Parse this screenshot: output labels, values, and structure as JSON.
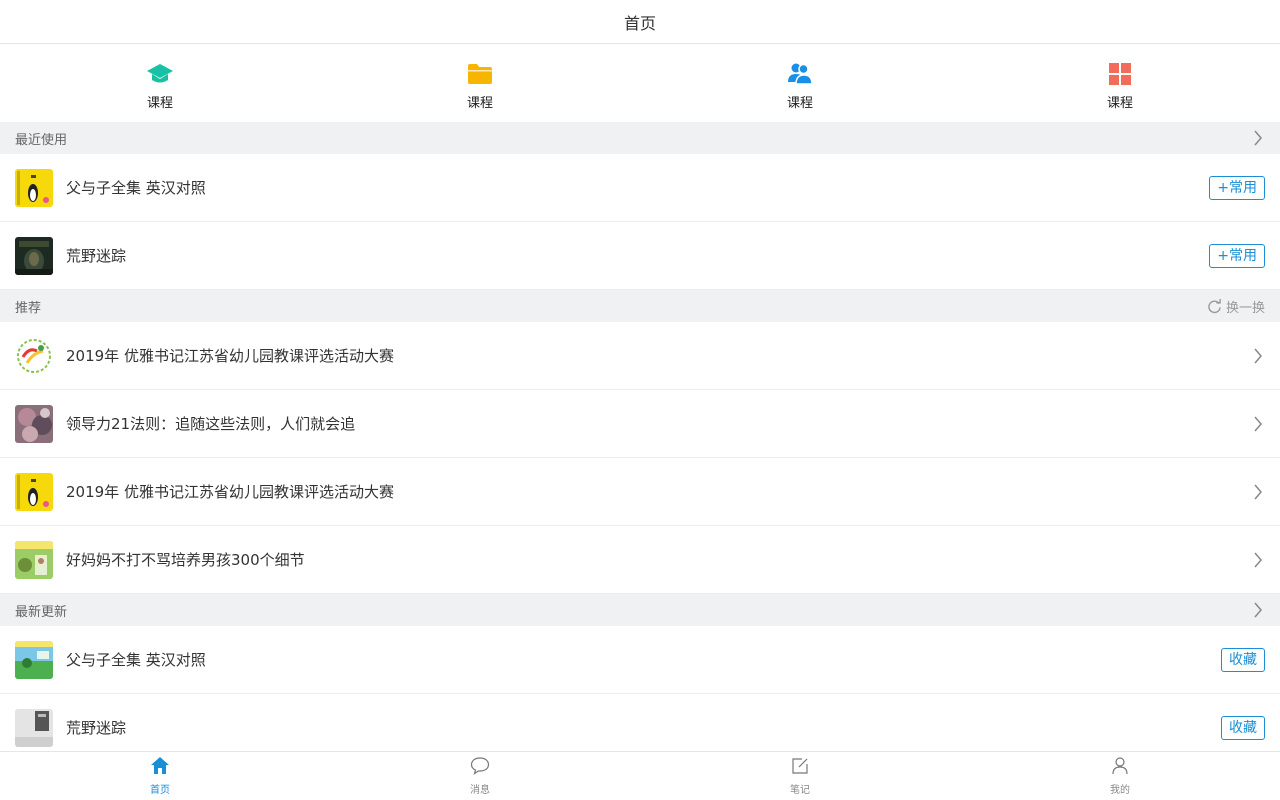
{
  "header": {
    "title": "首页"
  },
  "quicknav": [
    {
      "label": "课程",
      "icon": "graduation-cap-icon",
      "color": "#16c2a3"
    },
    {
      "label": "课程",
      "icon": "folder-icon",
      "color": "#f7b500"
    },
    {
      "label": "课程",
      "icon": "users-icon",
      "color": "#1a8fe8"
    },
    {
      "label": "课程",
      "icon": "grid-icon",
      "color": "#f26b5b"
    }
  ],
  "recent": {
    "title": "最近使用",
    "items": [
      {
        "title": "父与子全集 英汉对照",
        "action": "+常用"
      },
      {
        "title": "荒野迷踪",
        "action": "+常用"
      }
    ]
  },
  "recommend": {
    "title": "推荐",
    "refresh_label": "换一换",
    "items": [
      {
        "title": "2019年 优雅书记江苏省幼儿园教课评选活动大赛"
      },
      {
        "title": "领导力21法则：追随这些法则，人们就会追"
      },
      {
        "title": "2019年 优雅书记江苏省幼儿园教课评选活动大赛"
      },
      {
        "title": "好妈妈不打不骂培养男孩300个细节"
      }
    ]
  },
  "latest": {
    "title": "最新更新",
    "items": [
      {
        "title": "父与子全集 英汉对照",
        "action": "收藏"
      },
      {
        "title": "荒野迷踪",
        "action": "收藏"
      }
    ]
  },
  "tabbar": [
    {
      "label": "首页",
      "icon": "home-icon",
      "active": true
    },
    {
      "label": "消息",
      "icon": "message-icon",
      "active": false
    },
    {
      "label": "笔记",
      "icon": "note-icon",
      "active": false
    },
    {
      "label": "我的",
      "icon": "profile-icon",
      "active": false
    }
  ],
  "colors": {
    "accent": "#1a8fd6",
    "section_bg": "#f0f1f3"
  }
}
